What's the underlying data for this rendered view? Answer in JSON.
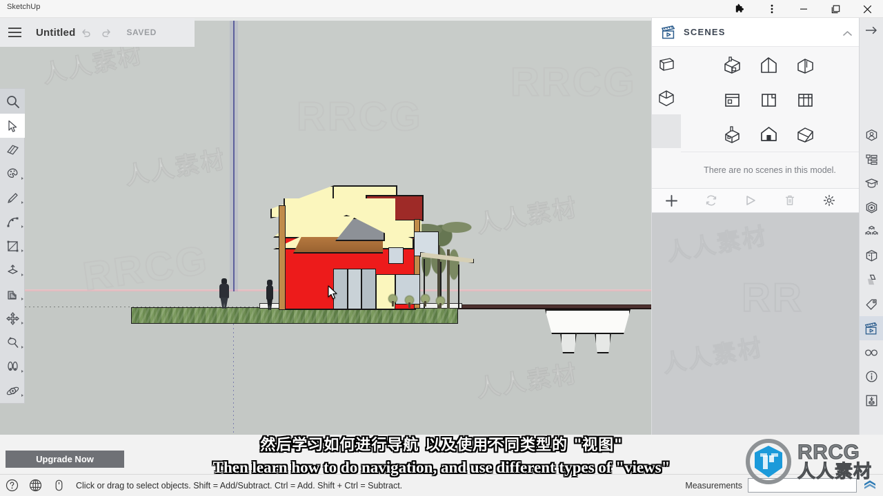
{
  "window": {
    "app_name": "SketchUp",
    "controls": [
      {
        "name": "extensions-icon",
        "glyph": "puzzle"
      },
      {
        "name": "more-options-icon",
        "glyph": "kebab"
      },
      {
        "name": "minimize-button",
        "glyph": "minimize"
      },
      {
        "name": "maximize-button",
        "glyph": "maximize"
      },
      {
        "name": "close-button",
        "glyph": "close"
      }
    ]
  },
  "header": {
    "menu_label": "Menu",
    "document_title": "Untitled",
    "undo_label": "Undo",
    "redo_label": "Redo",
    "save_status": "SAVED"
  },
  "left_toolbar": {
    "items": [
      {
        "name": "search-tool",
        "label": "Search",
        "active": false,
        "caret": false
      },
      {
        "name": "select-tool",
        "label": "Select",
        "active": true,
        "caret": false
      },
      {
        "name": "eraser-tool",
        "label": "Eraser",
        "active": false,
        "caret": false
      },
      {
        "name": "paint-bucket-tool",
        "label": "Paint Bucket",
        "active": false,
        "caret": true
      },
      {
        "name": "line-tool",
        "label": "Line",
        "active": false,
        "caret": true
      },
      {
        "name": "arc-tool",
        "label": "Arc",
        "active": false,
        "caret": true
      },
      {
        "name": "rectangle-tool",
        "label": "Rectangle",
        "active": false,
        "caret": true
      },
      {
        "name": "push-pull-tool",
        "label": "Push/Pull",
        "active": false,
        "caret": true
      },
      {
        "name": "offset-tool",
        "label": "Offset",
        "active": false,
        "caret": true
      },
      {
        "name": "move-tool",
        "label": "Move",
        "active": false,
        "caret": true
      },
      {
        "name": "rotate-tool",
        "label": "Rotate",
        "active": false,
        "caret": true
      },
      {
        "name": "tape-measure-tool",
        "label": "Tape Measure",
        "active": false,
        "caret": true
      },
      {
        "name": "orbit-tool",
        "label": "Orbit",
        "active": false,
        "caret": true
      }
    ]
  },
  "right_rail": {
    "items": [
      {
        "name": "collapse-panel-arrow-icon",
        "label": "Collapse Panel"
      },
      {
        "name": "entity-info-icon",
        "label": "Entity Info"
      },
      {
        "name": "outliner-icon",
        "label": "Outliner"
      },
      {
        "name": "instructor-icon",
        "label": "Instructor"
      },
      {
        "name": "materials-icon",
        "label": "Materials"
      },
      {
        "name": "components-icon",
        "label": "Components"
      },
      {
        "name": "styles-icon",
        "label": "Styles"
      },
      {
        "name": "shadows-icon",
        "label": "Shadows"
      },
      {
        "name": "tags-icon",
        "label": "Tags"
      },
      {
        "name": "scenes-icon",
        "label": "Scenes",
        "selected": true
      },
      {
        "name": "display-icon",
        "label": "Display"
      },
      {
        "name": "model-info-icon",
        "label": "Model Info"
      },
      {
        "name": "export-icon",
        "label": "Export"
      }
    ]
  },
  "scenes_panel": {
    "title": "SCENES",
    "empty_message": "There are no scenes in this model.",
    "projection_toggles": [
      {
        "name": "perspective-toggle",
        "label": "Perspective"
      },
      {
        "name": "parallel-projection-toggle",
        "label": "Parallel Projection"
      }
    ],
    "standard_views": [
      {
        "name": "view-iso",
        "label": "Iso"
      },
      {
        "name": "view-top",
        "label": "Top"
      },
      {
        "name": "view-front",
        "label": "Front"
      },
      {
        "name": "view-right",
        "label": "Right"
      },
      {
        "name": "view-back",
        "label": "Back"
      },
      {
        "name": "view-left",
        "label": "Left"
      },
      {
        "name": "view-bottom",
        "label": "Bottom"
      },
      {
        "name": "view-elevation",
        "label": "Elevation"
      },
      {
        "name": "view-custom",
        "label": "Custom"
      }
    ],
    "toolbar": [
      {
        "name": "add-scene-button",
        "label": "Add Scene",
        "enabled": true
      },
      {
        "name": "update-scene-button",
        "label": "Update Scene",
        "enabled": false
      },
      {
        "name": "play-animation-button",
        "label": "Play Animation",
        "enabled": false
      },
      {
        "name": "delete-scene-button",
        "label": "Delete Scene",
        "enabled": false
      },
      {
        "name": "scene-settings-button",
        "label": "Settings",
        "enabled": true
      }
    ]
  },
  "upgrade": {
    "label": "Upgrade Now"
  },
  "statusbar": {
    "help_label": "Help",
    "globe_label": "Geo-location",
    "mouse_label": "Mouse Tips",
    "message": "Click or drag to select objects. Shift = Add/Subtract. Ctrl = Add. Shift + Ctrl = Subtract.",
    "measurements_label": "Measurements",
    "measurements_value": "",
    "measurements_placeholder": ""
  },
  "subtitles": {
    "chinese": "然后学习如何进行导航 以及使用不同类型的 \"视图\"",
    "english": "Then learn how to do navigation, and use different types of \"views\""
  },
  "watermark": {
    "brand_en": "RRCG",
    "brand_cn": "人人素材",
    "overlays": [
      "RRCG",
      "人人素材",
      "RRCG",
      "人人素材",
      "RRCG"
    ]
  },
  "colors": {
    "canvas_sky": "#c8ccc9",
    "canvas_ground": "#c4c8c5",
    "blue_axis": "#5c5f9c",
    "red_axis": "#dfb6bb",
    "house_wall_red": "#ed1b1b",
    "house_roof_yellow": "#fbf6bd",
    "house_roof_red": "#9e2a27",
    "grass_green": "#5d7d46",
    "accent_blue": "#2e5e8e",
    "upgrade_grey": "#6f7176"
  },
  "model": {
    "name": "house-model",
    "description": "Two-story house front elevation with red walls, yellow gable roof, palm tree, pool and two scale figures"
  }
}
